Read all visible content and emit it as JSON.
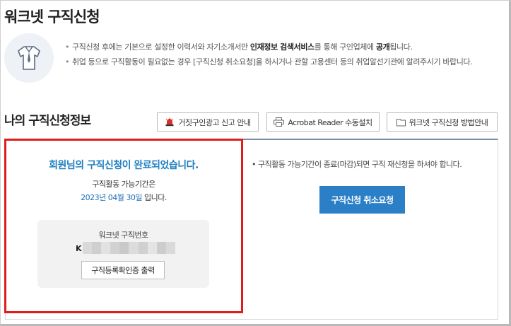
{
  "page": {
    "title": "워크넷 구직신청"
  },
  "notice": {
    "line1_pre": "구직신청 후에는 기본으로 설정한 이력서와 자기소개서만 ",
    "line1_bold1": "인재정보 검색서비스",
    "line1_mid": "를 통해 구인업체에 ",
    "line1_bold2": "공개",
    "line1_post": "됩니다.",
    "line2": "취업 등으로 구직활동이 필요없는 경우 [구직신청 취소요청]을 하시거나 관할 고용센터 등의 취업알선기관에 알려주시기 바랍니다."
  },
  "section": {
    "title": "나의 구직신청정보"
  },
  "toolbar": {
    "fake_ad_label": "거짓구인광고 신고 안내",
    "acrobat_label": "Acrobat Reader 수동설치",
    "guide_label": "워크넷 구직신청 방법안내"
  },
  "status": {
    "complete_message": "회원님의 구직신청이 완료되었습니다.",
    "period_label": "구직활동 가능기간은",
    "period_date": "2023년 04월 30일",
    "period_suffix": " 입니다."
  },
  "registration": {
    "label": "워크넷 구직번호",
    "prefix": "K",
    "print_button": "구직등록확인증 출력"
  },
  "right_panel": {
    "note": "구직활동 가능기간이 종료(마감)되면 구직 재신청을 하셔야 합니다.",
    "cancel_button": "구직신청 취소요청"
  },
  "icons": {
    "shirt": "shirt-icon",
    "siren": "siren-icon",
    "printer": "printer-icon",
    "folder": "folder-icon"
  },
  "colors": {
    "accent_blue": "#2b7fc7",
    "message_blue": "#1e7fc0",
    "highlight_red": "#e01d1d"
  }
}
